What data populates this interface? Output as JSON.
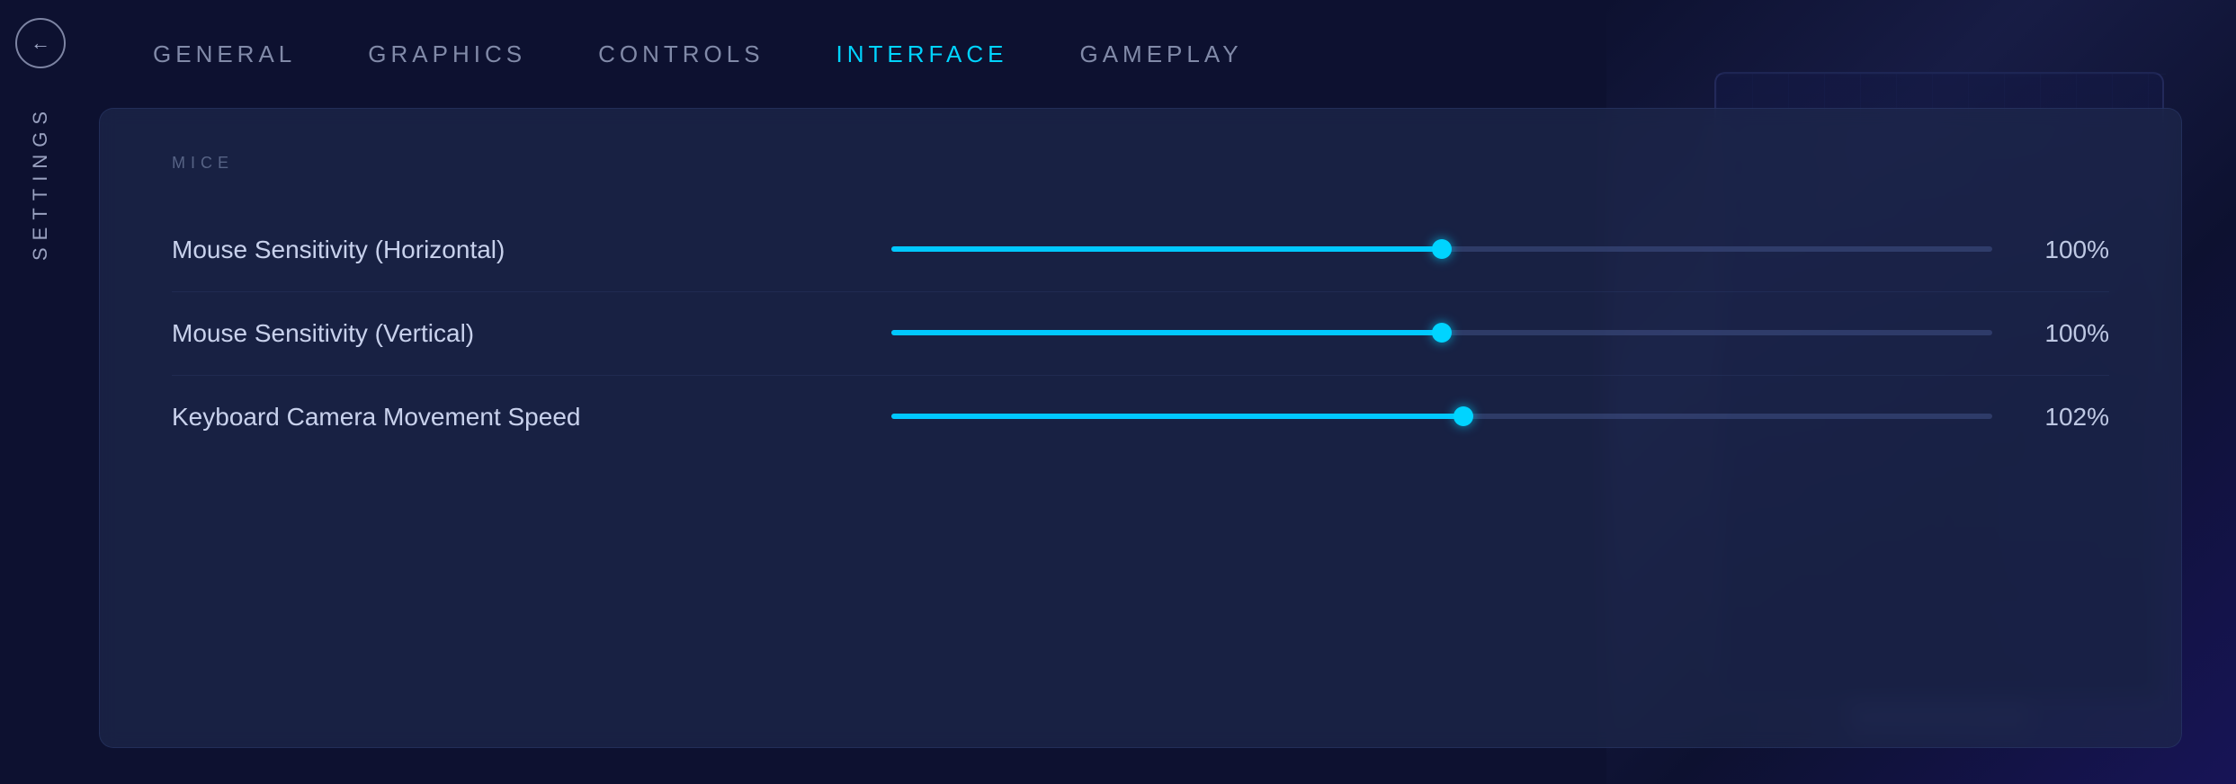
{
  "sidebar": {
    "settings_label": "SETTINGS",
    "back_button_icon": "←"
  },
  "nav": {
    "items": [
      {
        "id": "general",
        "label": "GENERAL",
        "active": false
      },
      {
        "id": "graphics",
        "label": "GRAPHICS",
        "active": false
      },
      {
        "id": "controls",
        "label": "CONTROLS",
        "active": false
      },
      {
        "id": "interface",
        "label": "INTERFACE",
        "active": true
      },
      {
        "id": "gameplay",
        "label": "GAMEPLAY",
        "active": false
      }
    ]
  },
  "panel": {
    "title": "MICE",
    "settings": [
      {
        "id": "mouse-horizontal",
        "label": "Mouse Sensitivity (Horizontal)",
        "value": "100%",
        "fill_percent": 50
      },
      {
        "id": "mouse-vertical",
        "label": "Mouse Sensitivity (Vertical)",
        "value": "100%",
        "fill_percent": 50
      },
      {
        "id": "keyboard-camera",
        "label": "Keyboard Camera Movement Speed",
        "value": "102%",
        "fill_percent": 52
      }
    ]
  },
  "colors": {
    "accent": "#00d4ff",
    "active_nav": "#00d4ff",
    "inactive_nav": "rgba(180, 190, 220, 0.7)"
  }
}
